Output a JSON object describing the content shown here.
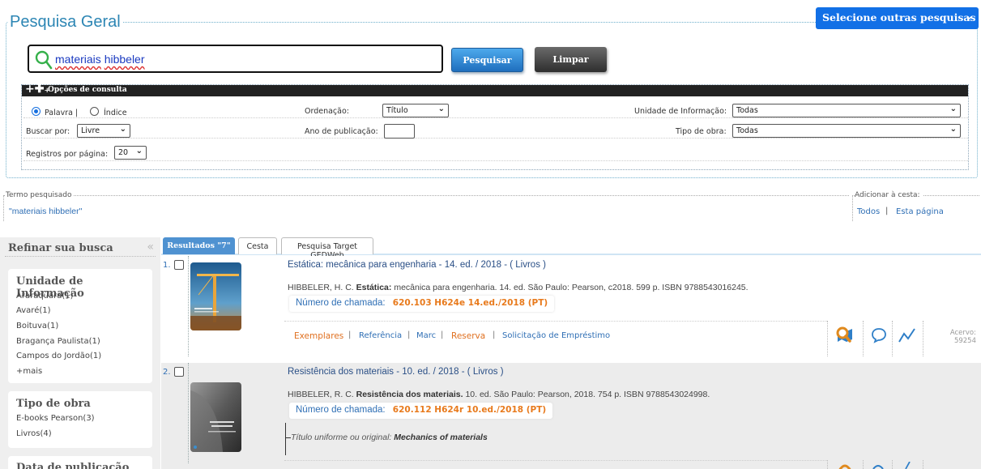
{
  "header": {
    "title": "Pesquisa Geral",
    "other_searches_label": "Selecione outras pesquisas",
    "search_value": "materiais hibbeler",
    "search_word1": "materiais",
    "search_word2": "hibbeler",
    "search_button": "Pesquisar",
    "clear_button": "Limpar"
  },
  "options": {
    "title": "Opções de consulta",
    "radio_palavra": "Palavra |",
    "radio_indice": "Índice",
    "buscar_por_label": "Buscar por:",
    "buscar_por_value": "Livre",
    "registros_label": "Registros por página:",
    "registros_value": "20",
    "ordenacao_label": "Ordenação:",
    "ordenacao_value": "Título",
    "ano_label": "Ano de publicação:",
    "unidade_label": "Unidade de Informação:",
    "unidade_value": "Todas",
    "tipo_label": "Tipo de obra:",
    "tipo_value": "Todas"
  },
  "term": {
    "caption": "Termo pesquisado",
    "value": "\"materiais hibbeler\""
  },
  "basket": {
    "caption": "Adicionar à cesta:",
    "all": "Todos",
    "sep": "|",
    "page": "Esta página"
  },
  "sidebar": {
    "title": "Refinar sua busca",
    "facets": [
      {
        "heading": "Unidade de Informação",
        "items": [
          "Araraquara(1)",
          "Avaré(1)",
          "Boituva(1)",
          "Bragança Paulista(1)",
          "Campos do Jordão(1)",
          "+mais"
        ]
      },
      {
        "heading": "Tipo de obra",
        "items": [
          "E-books Pearson(3)",
          "Livros(4)"
        ]
      },
      {
        "heading": "Data de publicação",
        "items": []
      }
    ]
  },
  "tabs": [
    "Resultados \"7\"",
    "Cesta",
    "Pesquisa Target GEDWeb"
  ],
  "results": [
    {
      "num": "1.",
      "title": "Estática: mecânica para engenharia - 14. ed. / 2018 - ( Livros )",
      "author": "HIBBELER, H. C.",
      "ref_bold": "Estática:",
      "ref_rest": "mecânica para engenharia. 14. ed. São Paulo: Pearson, c2018. 599 p. ISBN 9788543016245.",
      "call_label": "Número de chamada:",
      "call_value": "620.103 H624e 14.ed./2018 (PT)",
      "actions": [
        "Exemplares",
        "Referência",
        "Marc",
        "Reserva",
        "Solicitação de Empréstimo"
      ],
      "acervo_label": "Acervo:",
      "acervo_value": "59254"
    },
    {
      "num": "2.",
      "title": "Resistência dos materiais - 10. ed. / 2018 - ( Livros )",
      "author": "HIBBELER, R. C.",
      "ref_bold": "Resistência dos materiais.",
      "ref_rest": "10. ed. São Paulo: Pearson, 2018. 754 p. ISBN 9788543024998.",
      "call_label": "Número de chamada:",
      "call_value": "620.112 H624r 10.ed./2018 (PT)",
      "uniform_label": "Título uniforme ou original:",
      "uniform_value": "Mechanics of materials"
    }
  ],
  "colors": {
    "accent_blue": "#1270e6",
    "title_blue": "#2d86b4",
    "call_orange": "#e87a1c"
  }
}
